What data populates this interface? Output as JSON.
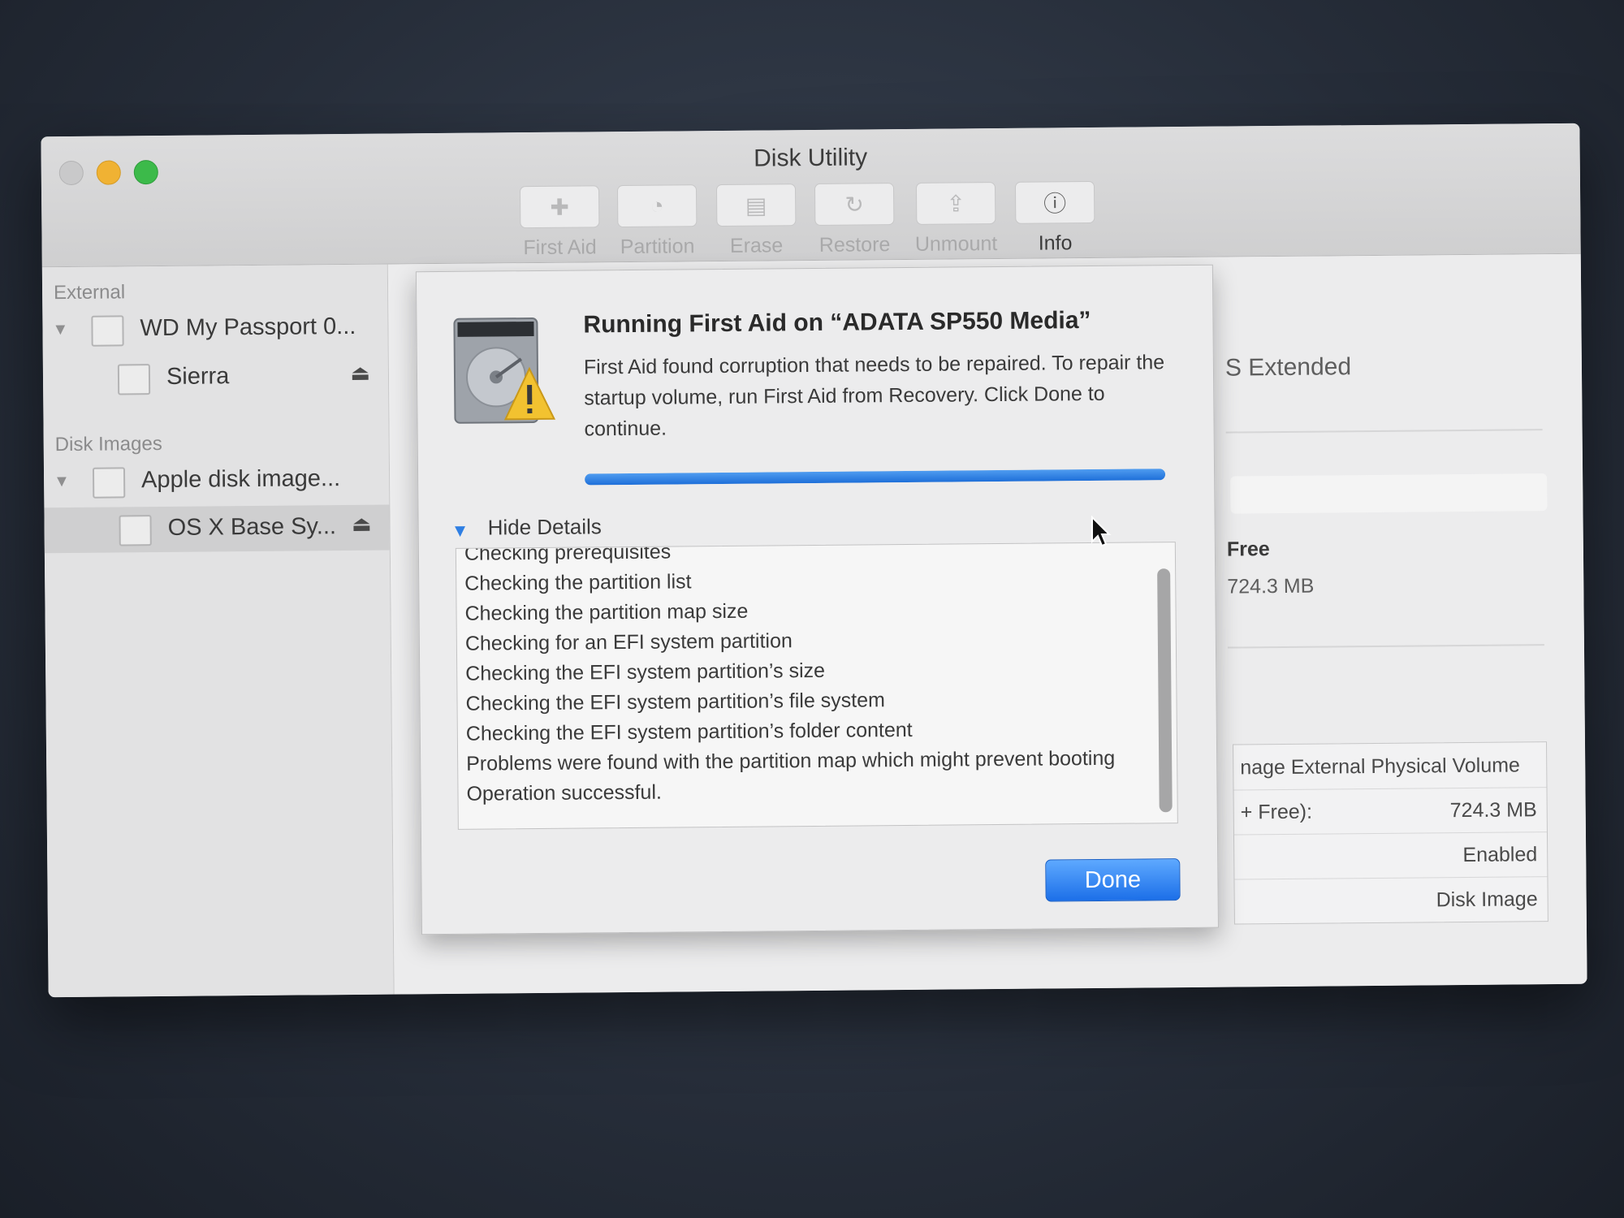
{
  "window": {
    "title": "Disk Utility"
  },
  "toolbar": {
    "items": [
      {
        "label": "First Aid",
        "icon": "first-aid-icon",
        "enabled": false
      },
      {
        "label": "Partition",
        "icon": "partition-icon",
        "enabled": false
      },
      {
        "label": "Erase",
        "icon": "erase-icon",
        "enabled": false
      },
      {
        "label": "Restore",
        "icon": "restore-icon",
        "enabled": false
      },
      {
        "label": "Unmount",
        "icon": "unmount-icon",
        "enabled": false
      },
      {
        "label": "Info",
        "icon": "info-icon",
        "enabled": true
      }
    ]
  },
  "sidebar": {
    "external_header": "External",
    "external_items": [
      {
        "label": "WD My Passport 0...",
        "expanded": true
      },
      {
        "label": "Sierra",
        "eject": true
      }
    ],
    "disk_images_header": "Disk Images",
    "disk_image_items": [
      {
        "label": "Apple disk image...",
        "expanded": true
      },
      {
        "label": "OS X Base Sy...",
        "eject": true,
        "selected": true
      }
    ]
  },
  "content": {
    "format_fragment": "S Extended",
    "free_label": "Free",
    "free_value": "724.3 MB",
    "info_rows": [
      {
        "left": "nage External Physical Volume",
        "right": ""
      },
      {
        "left": "+ Free):",
        "right": "724.3 MB"
      },
      {
        "left": "",
        "right": "Enabled"
      },
      {
        "left": "",
        "right": "Disk Image"
      }
    ]
  },
  "sheet": {
    "title": "Running First Aid on “ADATA SP550 Media”",
    "message": "First Aid found corruption that needs to be repaired. To repair the startup volume, run First Aid from Recovery. Click Done to continue.",
    "progress": 1.0,
    "disclosure_label": "Hide Details",
    "details_lines": [
      "Checking prerequisites",
      "Checking the partition list",
      "Checking the partition map size",
      "Checking for an EFI system partition",
      "Checking the EFI system partition’s size",
      "Checking the EFI system partition’s file system",
      "Checking the EFI system partition’s folder content",
      "Problems were found with the partition map which might prevent booting",
      "Operation successful."
    ],
    "done_label": "Done"
  },
  "colors": {
    "accent": "#1e6fd9",
    "close": "#c9c9ca",
    "minimize": "#f0b233",
    "zoom": "#3cba4a",
    "warning": "#f2c230"
  }
}
